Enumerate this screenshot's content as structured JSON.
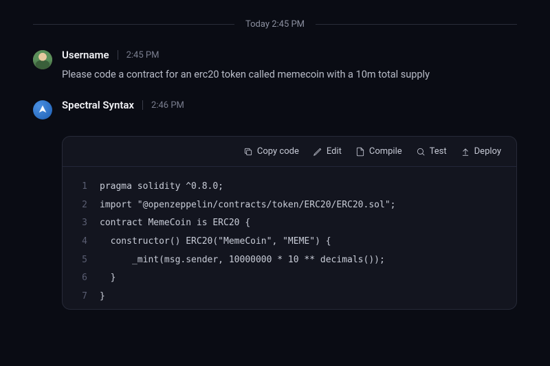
{
  "divider": {
    "label": "Today 2:45 PM"
  },
  "messages": [
    {
      "name": "Username",
      "time": "2:45 PM",
      "text": "Please code a contract for an erc20 token called memecoin with a 10m total supply"
    },
    {
      "name": "Spectral Syntax",
      "time": "2:46 PM"
    }
  ],
  "toolbar": {
    "copy": "Copy code",
    "edit": "Edit",
    "compile": "Compile",
    "test": "Test",
    "deploy": "Deploy"
  },
  "code": {
    "lines": [
      "pragma solidity ^0.8.0;",
      "import \"@openzeppelin/contracts/token/ERC20/ERC20.sol\";",
      "contract MemeCoin is ERC20 {",
      "  constructor() ERC20(\"MemeCoin\", \"MEME\") {",
      "      _mint(msg.sender, 10000000 * 10 ** decimals());",
      "  }",
      "}"
    ]
  }
}
